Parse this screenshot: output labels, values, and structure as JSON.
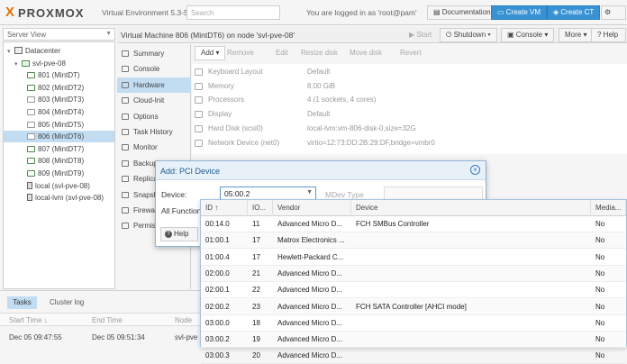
{
  "topbar": {
    "logo_x": "X",
    "logo_text": "PROXMOX",
    "version": "Virtual Environment 5.3-5",
    "search_placeholder": "Search",
    "logged_in": "You are logged in as 'root@pam'",
    "documentation": "Documentation",
    "create_vm": "Create VM",
    "create_ct": "Create CT"
  },
  "server_view": "Server View",
  "tree": [
    {
      "label": "Datacenter",
      "kind": "datacenter"
    },
    {
      "label": "svl-pve-08",
      "kind": "node"
    },
    {
      "label": "801 (MintDT)",
      "kind": "vm-on"
    },
    {
      "label": "802 (MintDT2)",
      "kind": "vm-on"
    },
    {
      "label": "803 (MintDT3)",
      "kind": "vm-off"
    },
    {
      "label": "804 (MintDT4)",
      "kind": "vm-off"
    },
    {
      "label": "805 (MintDT5)",
      "kind": "vm-off"
    },
    {
      "label": "806 (MintDT6)",
      "kind": "vm-off",
      "selected": true
    },
    {
      "label": "807 (MintDT7)",
      "kind": "vm-on"
    },
    {
      "label": "808 (MintDT8)",
      "kind": "vm-on"
    },
    {
      "label": "809 (MintDT9)",
      "kind": "vm-on"
    },
    {
      "label": "local (svl-pve-08)",
      "kind": "storage"
    },
    {
      "label": "local-lvm (svl-pve-08)",
      "kind": "storage"
    }
  ],
  "vm_header": {
    "title": "Virtual Machine 806 (MintDT6) on node 'svl-pve-08'",
    "start": "Start",
    "shutdown": "Shutdown",
    "console": "Console",
    "more": "More",
    "help": "Help"
  },
  "nav": [
    "Summary",
    "Console",
    "Hardware",
    "Cloud-Init",
    "Options",
    "Task History",
    "Monitor",
    "Backup",
    "Replication",
    "Snapshots",
    "Firewall",
    "Permissions"
  ],
  "nav_selected": "Hardware",
  "toolbar": [
    "Add",
    "Remove",
    "Edit",
    "Resize disk",
    "Move disk",
    "Revert"
  ],
  "hardware": [
    {
      "key": "Keyboard Layout",
      "value": "Default"
    },
    {
      "key": "Memory",
      "value": "8.00 GiB"
    },
    {
      "key": "Processors",
      "value": "4 (1 sockets, 4 cores)"
    },
    {
      "key": "Display",
      "value": "Default"
    },
    {
      "key": "Hard Disk (scsi0)",
      "value": "local-lvm:vm-806-disk-0,size=32G"
    },
    {
      "key": "Network Device (net0)",
      "value": "virtio=12:73:DD:2B:29:DF,bridge=vmbr0"
    }
  ],
  "dialog": {
    "title": "Add: PCI Device",
    "device_label": "Device:",
    "device_value": "05:00.2",
    "mdev_label": "MDev Type",
    "all_functions_label": "All Functions",
    "help_button": "Help"
  },
  "pci_grid": {
    "columns": [
      "ID ↑",
      "IO...",
      "Vendor",
      "Device",
      "Media..."
    ],
    "rows": [
      [
        "00:14.0",
        "11",
        "Advanced Micro D...",
        "FCH SMBus Controller",
        "No"
      ],
      [
        "01:00.1",
        "17",
        "Matrox Electronics ...",
        "",
        "No"
      ],
      [
        "01:00.4",
        "17",
        "Hewlett-Packard C...",
        "",
        "No"
      ],
      [
        "02:00.0",
        "21",
        "Advanced Micro D...",
        "",
        "No"
      ],
      [
        "02:00.1",
        "22",
        "Advanced Micro D...",
        "",
        "No"
      ],
      [
        "02:00.2",
        "23",
        "Advanced Micro D...",
        "FCH SATA Controller [AHCI mode]",
        "No"
      ],
      [
        "03:00.0",
        "18",
        "Advanced Micro D...",
        "",
        "No"
      ],
      [
        "03:00.2",
        "19",
        "Advanced Micro D...",
        "",
        "No"
      ],
      [
        "03:00.3",
        "20",
        "Advanced Micro D...",
        "",
        "No"
      ]
    ]
  },
  "tasks_panel": {
    "tab_tasks": "Tasks",
    "tab_cluster": "Cluster log",
    "col_start": "Start Time ↓",
    "col_end": "End Time",
    "col_node": "Node",
    "row_start": "Dec 05 09:47:55",
    "row_end": "Dec 05 09:51:34",
    "row_node": "svl-pve"
  }
}
